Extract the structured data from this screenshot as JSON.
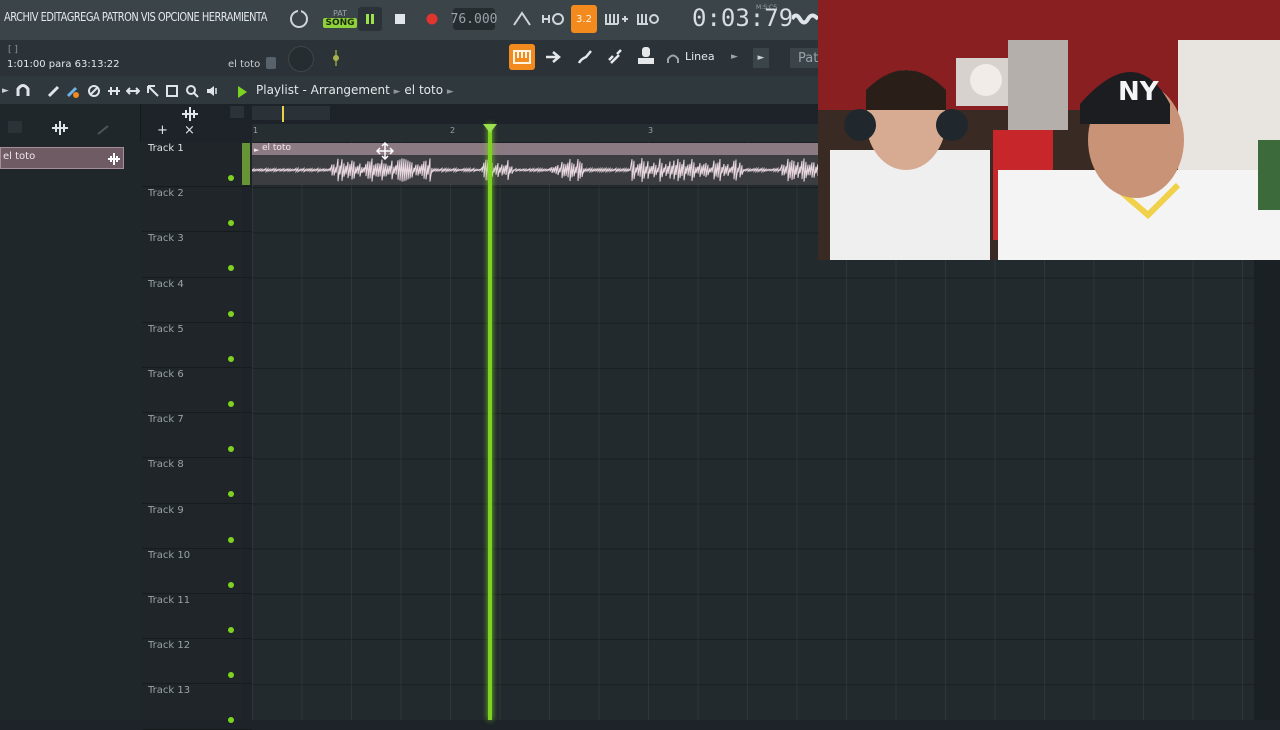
{
  "menu": {
    "text": "ARCHIV EDITAGREGA PATRON VIS OPCIONE HERRAMIENTA"
  },
  "transport": {
    "song_mode_small": "PAT",
    "song_mode_label": "SONG",
    "tempo": "76.000",
    "snap_display": "3.2",
    "timecode": "0:03:79",
    "timecode_unit": "M:S:CS"
  },
  "info": {
    "brackets": "[ ]",
    "position": "1:01:00 para 63:13:22",
    "pattern": "el toto",
    "snap": "Linea",
    "pattern_label": "Patr"
  },
  "playlist": {
    "title": "Playlist - Arrangement",
    "pattern": "el toto",
    "picker_item": "el toto",
    "clip_name": "el toto",
    "ruler": [
      "1",
      "2",
      "3"
    ],
    "tracks": [
      "Track 1",
      "Track 2",
      "Track 3",
      "Track 4",
      "Track 5",
      "Track 6",
      "Track 7",
      "Track 8",
      "Track 9",
      "Track 10",
      "Track 11",
      "Track 12",
      "Track 13"
    ]
  },
  "colors": {
    "accent": "#7ed321",
    "clip": "#8c7a82",
    "record": "#e0342f",
    "orange": "#f28a1e"
  },
  "icons": [
    "loop-icon",
    "pause-icon",
    "stop-icon",
    "record-icon",
    "metronome-icon",
    "pattern-loop-icon",
    "snap-icon",
    "typing-keyboard-icon",
    "step-edit-icon",
    "piano-icon",
    "arrow-icon",
    "brush-icon",
    "link-icon",
    "stamp-icon",
    "headphones-icon",
    "magnet-icon",
    "pencil-icon",
    "paint-icon",
    "mute-icon",
    "slip-icon",
    "select-icon",
    "zoom-icon",
    "speaker-icon",
    "plus-icon",
    "close-icon",
    "move-icon"
  ]
}
